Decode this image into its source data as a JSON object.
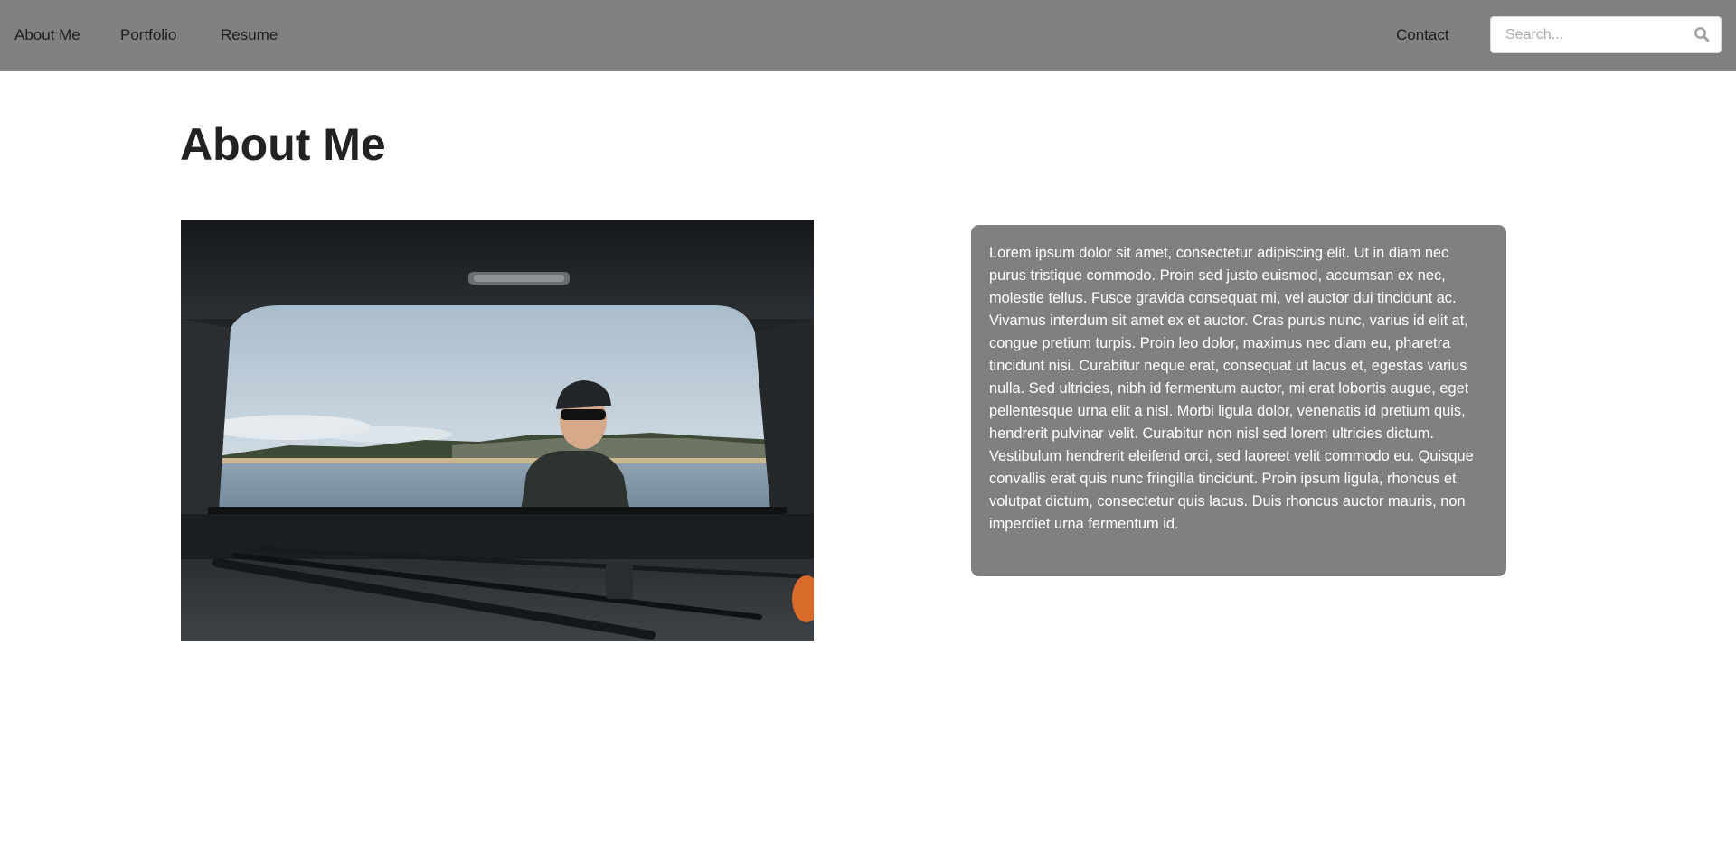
{
  "nav": {
    "links": [
      {
        "label": "About Me"
      },
      {
        "label": "Portfolio"
      },
      {
        "label": "Resume"
      }
    ],
    "contact_label": "Contact",
    "search": {
      "placeholder": "Search...",
      "value": "",
      "icon": "search-icon"
    }
  },
  "main": {
    "title": "About Me",
    "photo_icon": "photo-image",
    "bio": "Lorem ipsum dolor sit amet, consectetur adipiscing elit. Ut in diam nec purus tristique commodo. Proin sed justo euismod, accumsan ex nec, molestie tellus. Fusce gravida consequat mi, vel auctor dui tincidunt ac. Vivamus interdum sit amet ex et auctor. Cras purus nunc, varius id elit at, congue pretium turpis. Proin leo dolor, maximus nec diam eu, pharetra tincidunt nisi. Curabitur neque erat, consequat ut lacus et, egestas varius nulla. Sed ultricies, nibh id fermentum auctor, mi erat lobortis augue, eget pellentesque urna elit a nisl. Morbi ligula dolor, venenatis id pretium quis, hendrerit pulvinar velit. Curabitur non nisl sed lorem ultricies dictum. Vestibulum hendrerit eleifend orci, sed laoreet velit commodo eu. Quisque convallis erat quis nunc fringilla tincidunt. Proin ipsum ligula, rhoncus et volutpat dictum, consectetur quis lacus. Duis rhoncus auctor mauris, non imperdiet urna fermentum id."
  },
  "colors": {
    "navbar": "#808080",
    "card": "#808080",
    "title": "#222222",
    "nav_text": "#1e1e1e",
    "card_text": "#ffffff"
  }
}
